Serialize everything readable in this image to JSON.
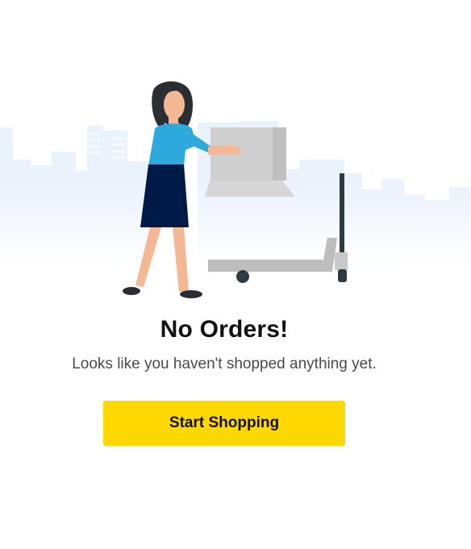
{
  "empty_state": {
    "illustration_icon": "woman-with-box-and-hand-truck-illustration",
    "title": "No Orders!",
    "message": "Looks like you haven't shopped anything yet.",
    "cta_label": "Start Shopping"
  },
  "colors": {
    "accent": "#FFD800",
    "title_text": "#111111",
    "body_text": "#4a4a4a",
    "skyline": "#E9F1FB"
  }
}
